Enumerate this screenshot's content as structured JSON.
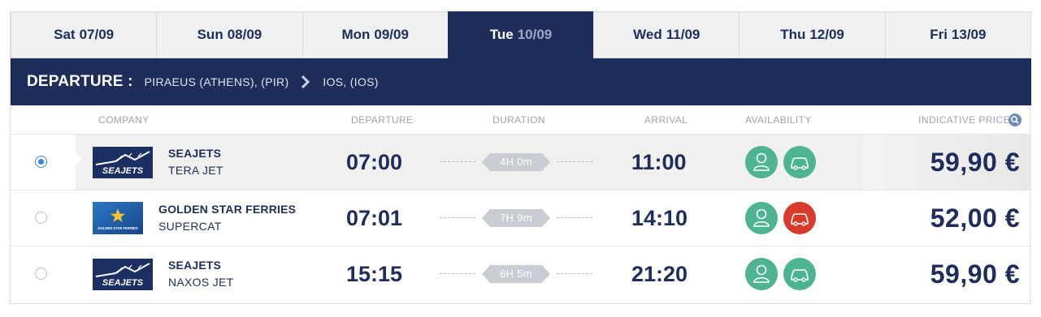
{
  "tabs": [
    {
      "day": "Sat",
      "date": "07/09",
      "active": false
    },
    {
      "day": "Sun",
      "date": "08/09",
      "active": false
    },
    {
      "day": "Mon",
      "date": "09/09",
      "active": false
    },
    {
      "day": "Tue",
      "date": "10/09",
      "active": true
    },
    {
      "day": "Wed",
      "date": "11/09",
      "active": false
    },
    {
      "day": "Thu",
      "date": "12/09",
      "active": false
    },
    {
      "day": "Fri",
      "date": "13/09",
      "active": false
    }
  ],
  "route": {
    "label": "DEPARTURE :",
    "from": "PIRAEUS (ATHENS), (PIR)",
    "to": "IOS, (IOS)"
  },
  "headers": {
    "company": "COMPANY",
    "departure": "DEPARTURE",
    "duration": "DURATION",
    "arrival": "ARRIVAL",
    "availability": "AVAILABILITY",
    "price": "INDICATIVE PRICE"
  },
  "icons": {
    "arrow": "chevron-right-icon",
    "search": "search-icon",
    "passenger": "passenger-icon",
    "vehicle": "car-icon"
  },
  "colors": {
    "navy": "#1e2d5a",
    "available": "#4db393",
    "unavailable": "#d63b2b",
    "radio": "#3a86d8"
  },
  "trips": [
    {
      "selected": true,
      "company": "SEAJETS",
      "vessel": "TERA JET",
      "logo_text": "SEAJETS",
      "departure": "07:00",
      "duration": "4H 0m",
      "arrival": "11:00",
      "passenger_available": true,
      "vehicle_available": true,
      "price": "59,90 €"
    },
    {
      "selected": false,
      "company": "GOLDEN STAR FERRIES",
      "vessel": "SUPERCAT",
      "logo_text": "GOLDEN STAR FERRIES",
      "departure": "07:01",
      "duration": "7H 9m",
      "arrival": "14:10",
      "passenger_available": true,
      "vehicle_available": false,
      "price": "52,00 €"
    },
    {
      "selected": false,
      "company": "SEAJETS",
      "vessel": "NAXOS JET",
      "logo_text": "SEAJETS",
      "departure": "15:15",
      "duration": "6H 5m",
      "arrival": "21:20",
      "passenger_available": true,
      "vehicle_available": true,
      "price": "59,90 €"
    }
  ]
}
